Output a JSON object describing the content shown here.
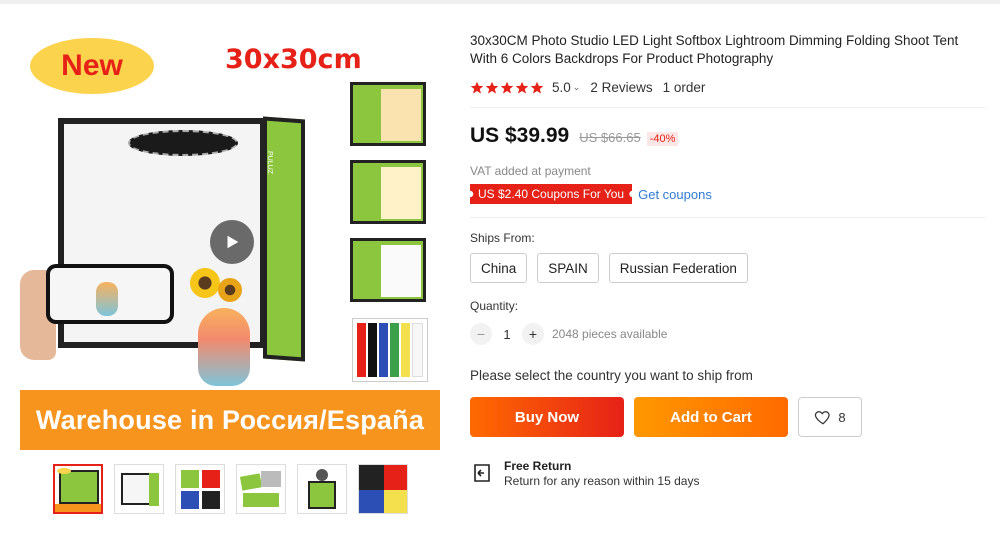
{
  "gallery": {
    "badge_text": "New",
    "size_text": "30x30cm",
    "box_logo": "PULUZ",
    "banner_text": "Warehouse in Россия/España",
    "thumbnails": [
      "thumb-1",
      "thumb-2",
      "thumb-3",
      "thumb-4",
      "thumb-5",
      "thumb-6"
    ]
  },
  "product": {
    "title": "30x30CM Photo Studio LED Light Softbox Lightroom Dimming Folding Shoot Tent With 6 Colors Backdrops For Product Photography",
    "rating": "5.0",
    "reviews": "2 Reviews",
    "orders": "1 order",
    "price": "US $39.99",
    "old_price": "US $66.65",
    "discount": "-40%",
    "vat": "VAT added at payment",
    "coupon": "US $2.40 Coupons For You",
    "get_coupons": "Get coupons",
    "ships_label": "Ships From:",
    "ships_from": [
      "China",
      "SPAIN",
      "Russian Federation"
    ],
    "quantity_label": "Quantity:",
    "quantity": "1",
    "available": "2048 pieces available",
    "notice": "Please select the country you want to ship from",
    "buy_now": "Buy Now",
    "add_to_cart": "Add to Cart",
    "wishlist_count": "8",
    "return_title": "Free Return",
    "return_desc": "Return for any reason within 15 days"
  },
  "colors": {
    "accent": "#e62117",
    "orange": "#ff6a00",
    "banner": "#f7941d",
    "box_green": "#8cc63f",
    "link": "#2f7bd3",
    "star": "#e62117"
  }
}
